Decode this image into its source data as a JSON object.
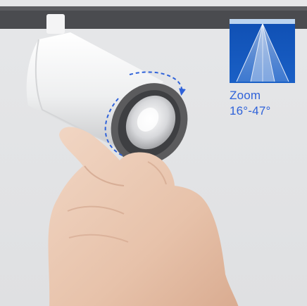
{
  "badge": {
    "title": "Zoom",
    "range": "16°-47°"
  },
  "colors": {
    "background": "#e4e5e7",
    "track": "#4a4b4f",
    "fixture_body": "#f1f2f3",
    "lens_ring": "#5b5b5d",
    "arrow": "#2f62d9",
    "beam_panel": "#1654b8",
    "label_text": "#2f62d9"
  },
  "icons": [
    "beam-angle-icon",
    "rotate-arrow-icon"
  ]
}
